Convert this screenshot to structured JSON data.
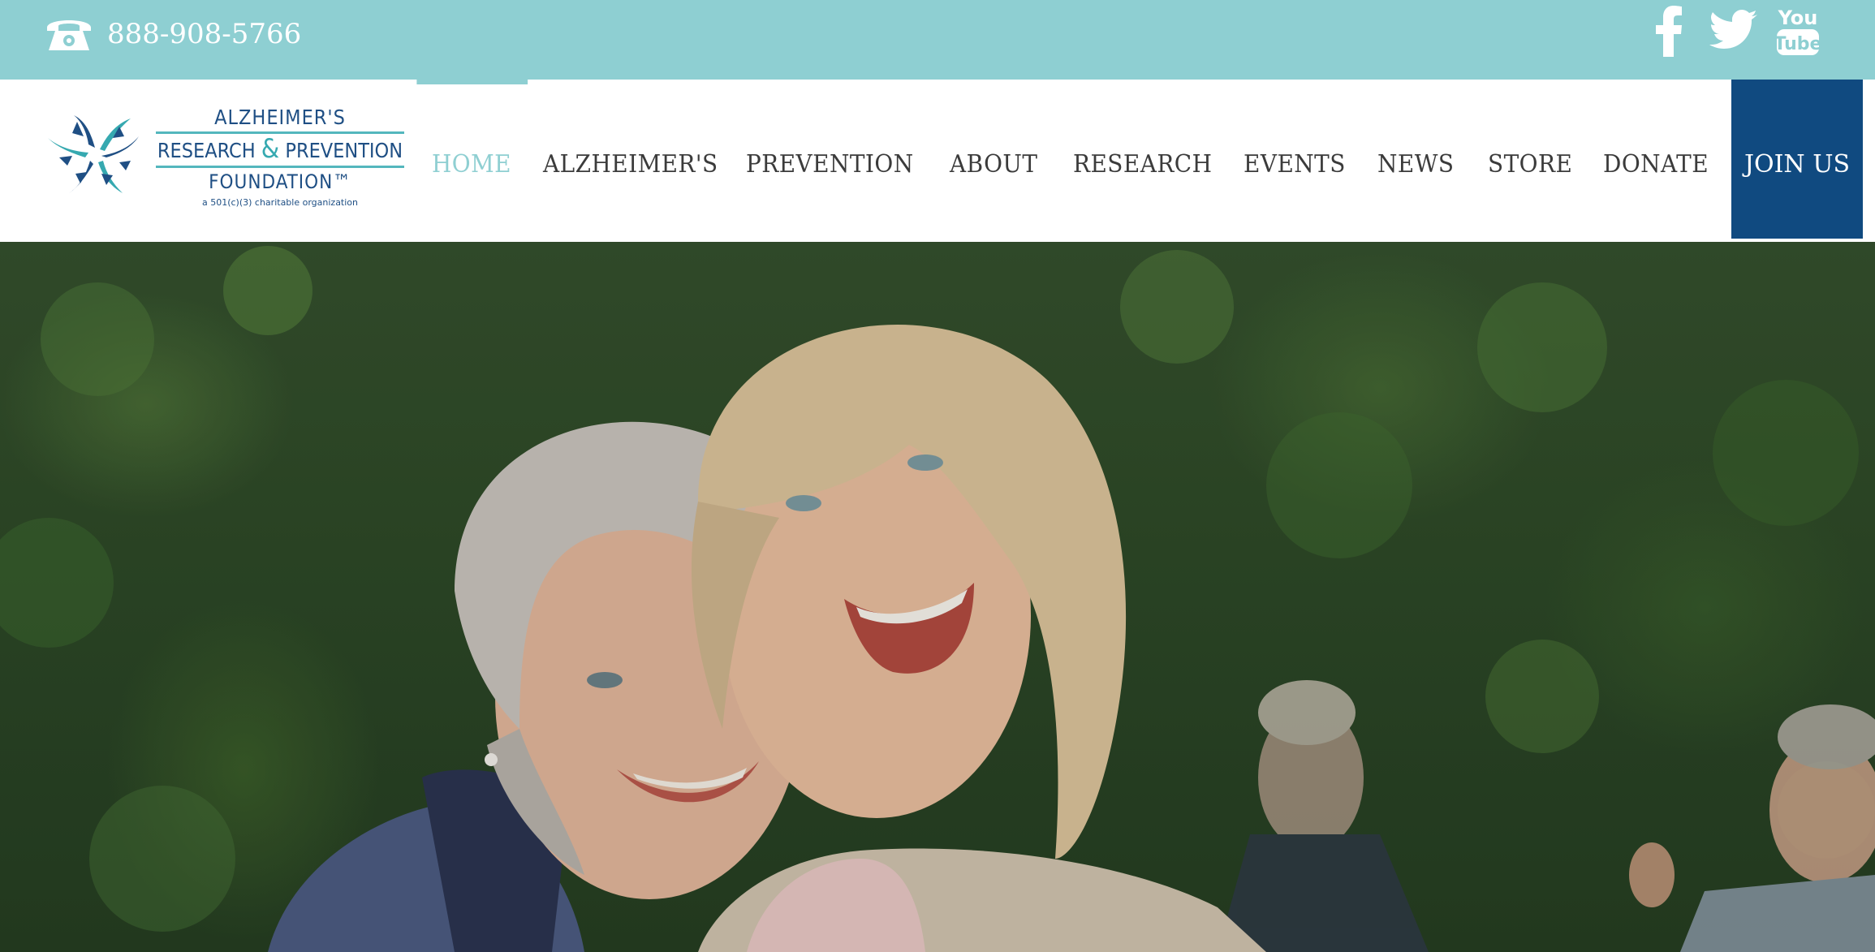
{
  "topbar": {
    "phone_icon": "phone-icon",
    "phone_number": "888-908-5766",
    "social": [
      {
        "name": "facebook-icon"
      },
      {
        "name": "twitter-icon"
      },
      {
        "name": "youtube-icon",
        "label_top": "You",
        "label_bottom": "Tube"
      }
    ],
    "background_color": "#8ecfd2"
  },
  "logo": {
    "line1": "ALZHEIMER'S",
    "line2_a": "RESEARCH",
    "line2_amp": "&",
    "line2_b": "PREVENTION",
    "line3": "FOUNDATION™",
    "tagline": "a 501(c)(3) charitable organization"
  },
  "nav": {
    "items": [
      {
        "label": "HOME",
        "active": true
      },
      {
        "label": "ALZHEIMER'S"
      },
      {
        "label": "PREVENTION"
      },
      {
        "label": "ABOUT"
      },
      {
        "label": "RESEARCH"
      },
      {
        "label": "EVENTS"
      },
      {
        "label": "NEWS"
      },
      {
        "label": "STORE"
      },
      {
        "label": "DONATE"
      }
    ],
    "join_label": "JOIN US",
    "active_color": "#8fcfd2",
    "join_color": "#104a80"
  },
  "hero": {
    "image": "two-smiling-women-hugging-outdoors"
  }
}
